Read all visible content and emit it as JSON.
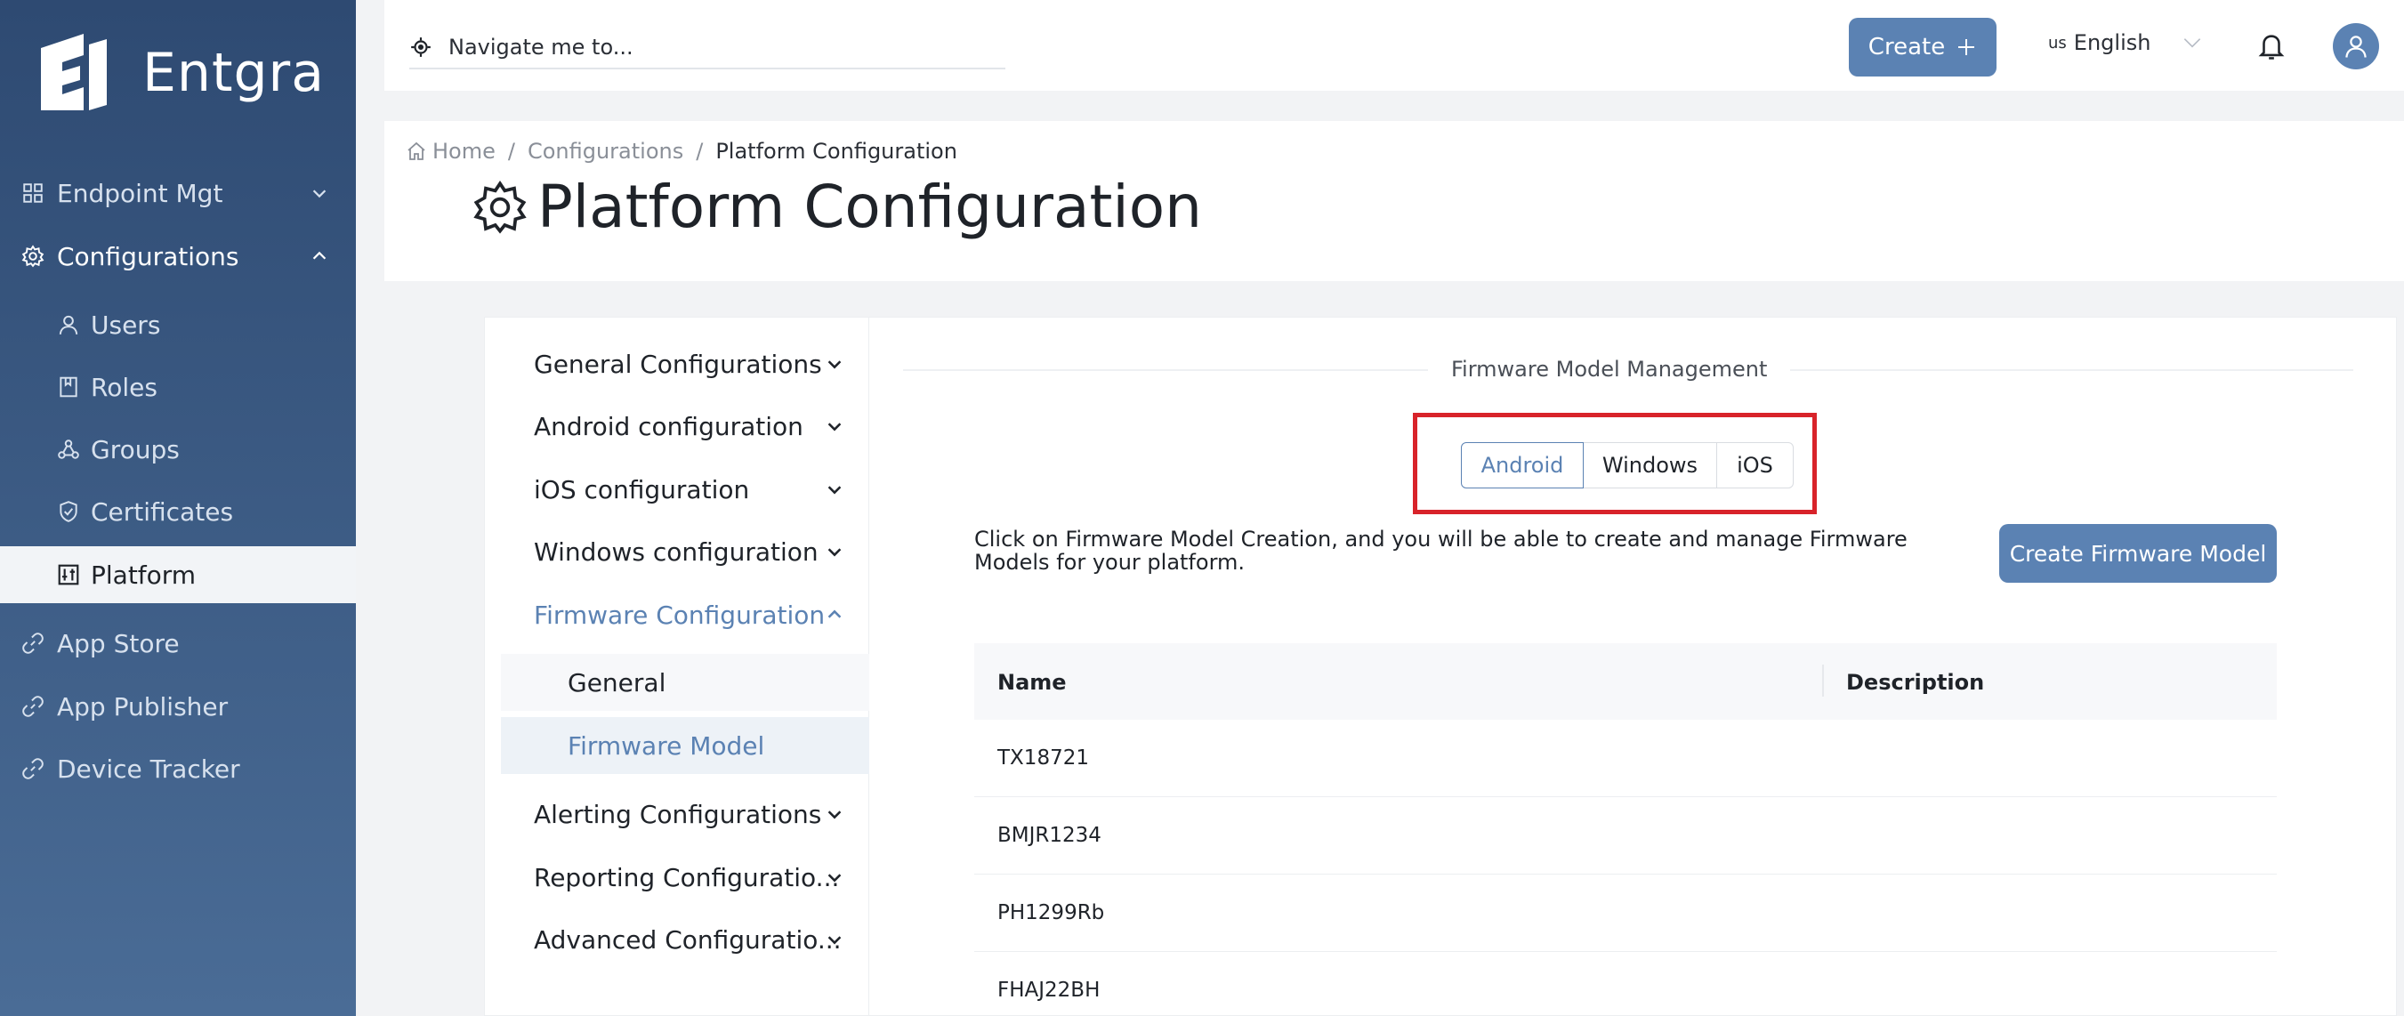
{
  "brand": {
    "name": "Entgra"
  },
  "sidebar": {
    "items": [
      {
        "label": "Endpoint Mgt",
        "icon": "grid-icon",
        "chevron": "down"
      },
      {
        "label": "Configurations",
        "icon": "gear-icon",
        "chevron": "up"
      },
      {
        "label": "Users",
        "icon": "user-icon"
      },
      {
        "label": "Roles",
        "icon": "book-icon"
      },
      {
        "label": "Groups",
        "icon": "groups-icon"
      },
      {
        "label": "Certificates",
        "icon": "shield-icon"
      },
      {
        "label": "Platform",
        "icon": "sliders-icon"
      },
      {
        "label": "App Store",
        "icon": "link-icon"
      },
      {
        "label": "App Publisher",
        "icon": "link-icon"
      },
      {
        "label": "Device Tracker",
        "icon": "link-icon"
      }
    ]
  },
  "topbar": {
    "search_text": "Navigate me to...",
    "create_label": "Create",
    "language_code": "us",
    "language": "English"
  },
  "breadcrumb": {
    "home": "Home",
    "configurations": "Configurations",
    "current": "Platform Configuration"
  },
  "page_title": "Platform Configuration",
  "submenu": {
    "items": [
      "General Configurations",
      "Android configuration",
      "iOS configuration",
      "Windows configuration",
      "Firmware Configuration",
      "Alerting Configurations",
      "Reporting Configuratio...",
      "Advanced Configuratio..."
    ],
    "firmware_children": [
      "General",
      "Firmware Model"
    ]
  },
  "main": {
    "section_title": "Firmware Model Management",
    "tabs": [
      "Android",
      "Windows",
      "iOS"
    ],
    "description": "Click on Firmware Model Creation, and you will be able to create and manage Firmware Models for your platform.",
    "create_button": "Create Firmware Model",
    "table": {
      "columns": [
        "Name",
        "Description"
      ],
      "rows": [
        "TX18721",
        "BMJR1234",
        "PH1299Rb",
        "FHAJ22BH"
      ]
    }
  },
  "colors": {
    "accent": "#5b82b3",
    "sidebar": "#2e4a72",
    "highlight": "#d8232a"
  }
}
